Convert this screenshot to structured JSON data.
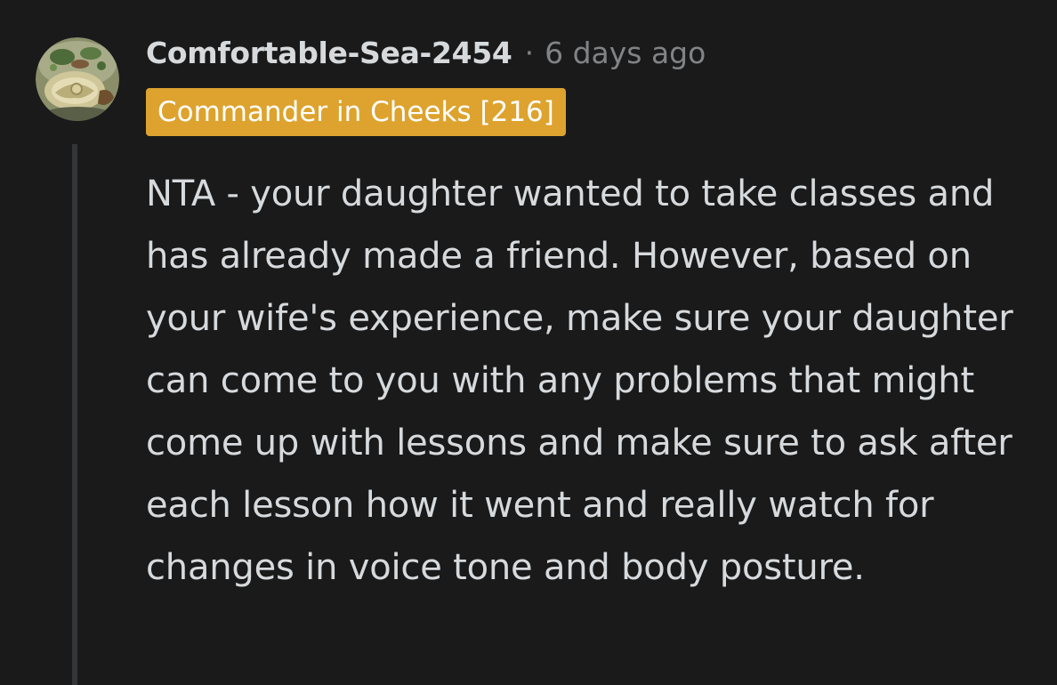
{
  "comment": {
    "author": "Comfortable-Sea-2454",
    "separator": "·",
    "timestamp": "6 days ago",
    "flair": "Commander in Cheeks [216]",
    "body": "NTA - your daughter wanted to take classes and has already made a friend. However, based on your wife's experience, make sure your daughter can come to you with any problems that might come up with lessons and make sure to ask after each lesson how it went and really watch for changes in voice tone and body posture."
  },
  "avatar": {
    "icon": "user-avatar-icon"
  },
  "colors": {
    "background": "#1a1a1b",
    "text": "#d7dadc",
    "muted": "#818384",
    "flair_bg": "#dda32e",
    "thread_line": "#343536"
  }
}
